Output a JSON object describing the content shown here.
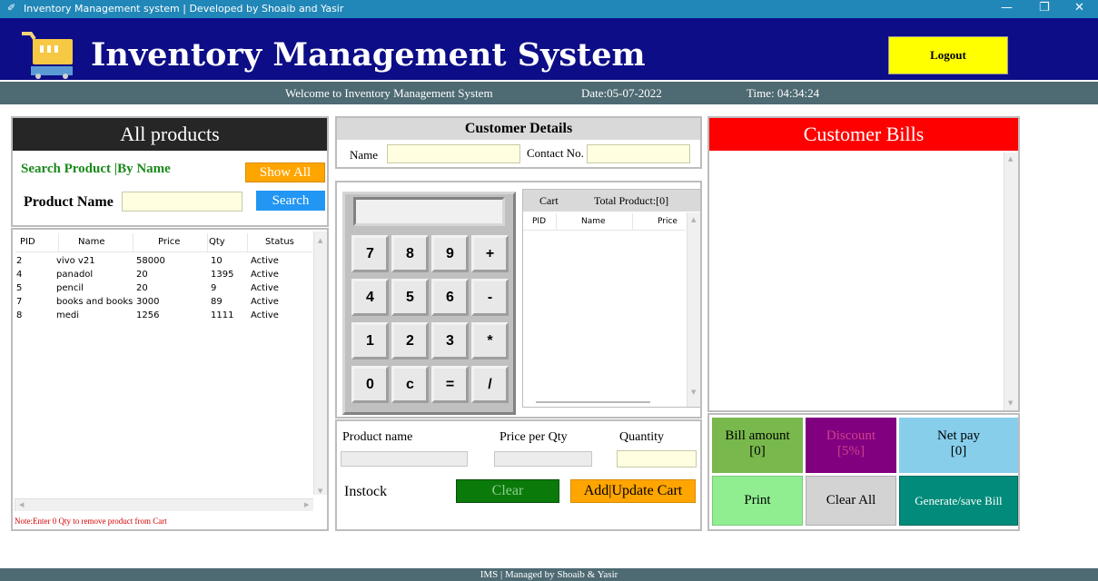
{
  "window": {
    "title": "Inventory Management system | Developed by Shoaib and Yasir",
    "minimize": "—",
    "restore": "❐",
    "close": "✕"
  },
  "header": {
    "title": "Inventory Management System",
    "logout": "Logout"
  },
  "strip": {
    "welcome": "Welcome to Inventory Management System",
    "date": "Date:05-07-2022",
    "time": "Time: 04:34:24"
  },
  "products": {
    "title": "All products",
    "search_heading": "Search Product |By Name",
    "show_all": "Show All",
    "product_name_label": "Product Name",
    "product_name_value": "",
    "search": "Search",
    "columns": [
      "PID",
      "Name",
      "Price",
      "Qty",
      "Status"
    ],
    "rows": [
      [
        "2",
        "vivo v21",
        "58000",
        "10",
        "Active"
      ],
      [
        "4",
        "panadol",
        "20",
        "1395",
        "Active"
      ],
      [
        "5",
        "pencil",
        "20",
        "9",
        "Active"
      ],
      [
        "7",
        "books and books",
        "3000",
        "89",
        "Active"
      ],
      [
        "8",
        "medi",
        "1256",
        "1111",
        "Active"
      ]
    ],
    "note": "Note:Enter 0 Qty to remove product from Cart"
  },
  "customer": {
    "title": "Customer Details",
    "name_label": "Name",
    "contact_label": "Contact No.",
    "name_value": "",
    "contact_value": ""
  },
  "calculator": {
    "display": "",
    "keys": [
      [
        "7",
        "8",
        "9",
        "+"
      ],
      [
        "4",
        "5",
        "6",
        "-"
      ],
      [
        "1",
        "2",
        "3",
        "*"
      ],
      [
        "0",
        "c",
        "=",
        "/"
      ]
    ]
  },
  "cart": {
    "title": "Cart",
    "total": "Total Product:[0]",
    "columns": [
      "PID",
      "Name",
      "Price"
    ]
  },
  "product_entry": {
    "name_label": "Product name",
    "price_label": "Price per Qty",
    "qty_label": "Quantity",
    "instock": "Instock",
    "clear": "Clear",
    "add_update": "Add|Update Cart"
  },
  "bills": {
    "title": "Customer Bills",
    "bill_amount_label": "Bill amount",
    "bill_amount_value": "[0]",
    "discount_label": "Discount",
    "discount_value": "[5%]",
    "net_pay_label": "Net pay",
    "net_pay_value": "[0]",
    "print": "Print",
    "clear_all": "Clear All",
    "generate": "Generate/save Bill"
  },
  "footer": {
    "text": "IMS | Managed by Shoaib & Yasir"
  },
  "colors": {
    "header_bg": "#0d0d87",
    "strip_bg": "#4e6a73",
    "bills_red": "#ff0000",
    "green_btn": "#0a7a0a",
    "orange_btn": "#ffa500",
    "search_btn": "#2196f3"
  }
}
